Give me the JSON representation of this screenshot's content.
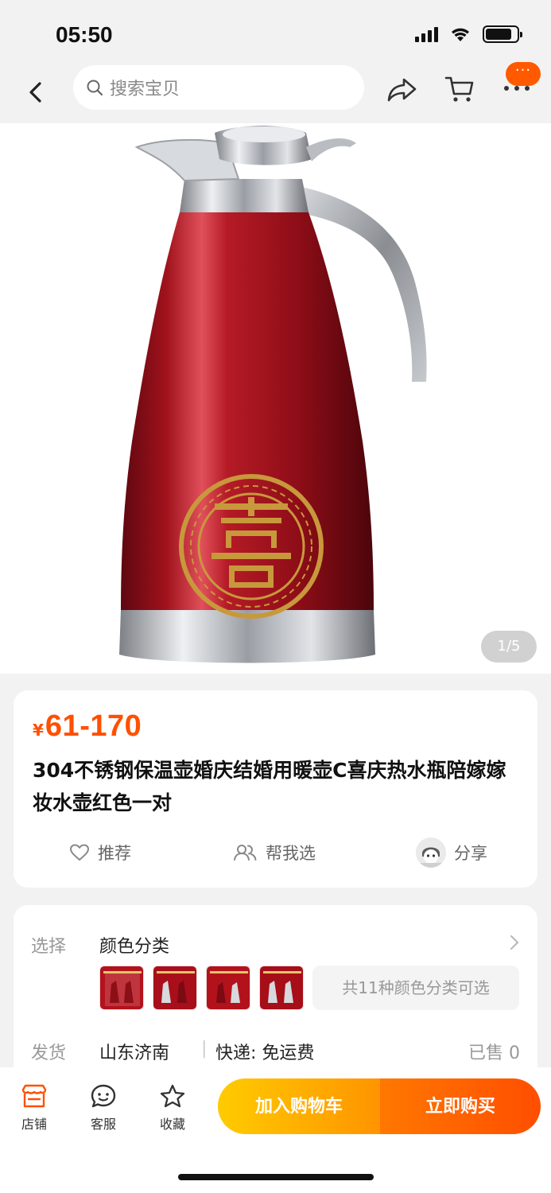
{
  "status_bar": {
    "time": "05:50",
    "icons": [
      "cellular-signal-icon",
      "wifi-icon",
      "battery-icon"
    ],
    "battery_level": 0.85
  },
  "nav": {
    "search_placeholder": "搜索宝贝",
    "more_badge": "···",
    "icons": [
      "back-arrow-icon",
      "search-icon",
      "share-icon",
      "cart-icon",
      "more-icon"
    ]
  },
  "gallery": {
    "counter": "1/5",
    "product_colors": {
      "body": "#a0121c",
      "steel": "#c9ccd1",
      "emblem": "#c8983c"
    }
  },
  "product": {
    "price_symbol": "¥",
    "price": "61-170",
    "title": "304不锈钢保温壶婚庆结婚用暖壶C喜庆热水瓶陪嫁嫁妆水壶红色一对",
    "price_color": "#ff5000"
  },
  "actions": {
    "recommend": "推荐",
    "help_choose": "帮我选",
    "share": "分享"
  },
  "options": {
    "select_label": "选择",
    "select_value": "颜色分类",
    "more_colors": "共11种颜色分类可选",
    "ship_label": "发货",
    "ship_origin": "山东济南",
    "separator": "|",
    "shipping": "快递: 免运费",
    "sold": "已售 0"
  },
  "bottom_bar": {
    "store": "店铺",
    "service": "客服",
    "favorite": "收藏",
    "add_to_cart": "加入购物车",
    "buy_now": "立即购买",
    "accent": "#ff5000"
  }
}
